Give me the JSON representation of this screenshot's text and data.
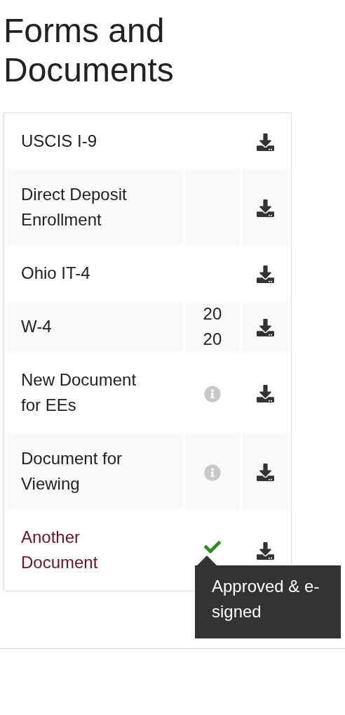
{
  "title": "Forms and Documents",
  "documents": [
    {
      "name": "USCIS I-9",
      "link": false,
      "status": {
        "kind": "none"
      }
    },
    {
      "name": "Direct Deposit Enrollment",
      "link": false,
      "status": {
        "kind": "none"
      }
    },
    {
      "name": "Ohio IT-4",
      "link": false,
      "status": {
        "kind": "none"
      }
    },
    {
      "name": "W-4",
      "link": false,
      "status": {
        "kind": "text",
        "text": "2020"
      }
    },
    {
      "name": "New Document for EEs",
      "link": false,
      "status": {
        "kind": "info"
      }
    },
    {
      "name": "Document for Viewing",
      "link": false,
      "status": {
        "kind": "info"
      }
    },
    {
      "name": "Another Document",
      "link": true,
      "status": {
        "kind": "check",
        "tooltip": "Approved & e-signed"
      }
    }
  ]
}
